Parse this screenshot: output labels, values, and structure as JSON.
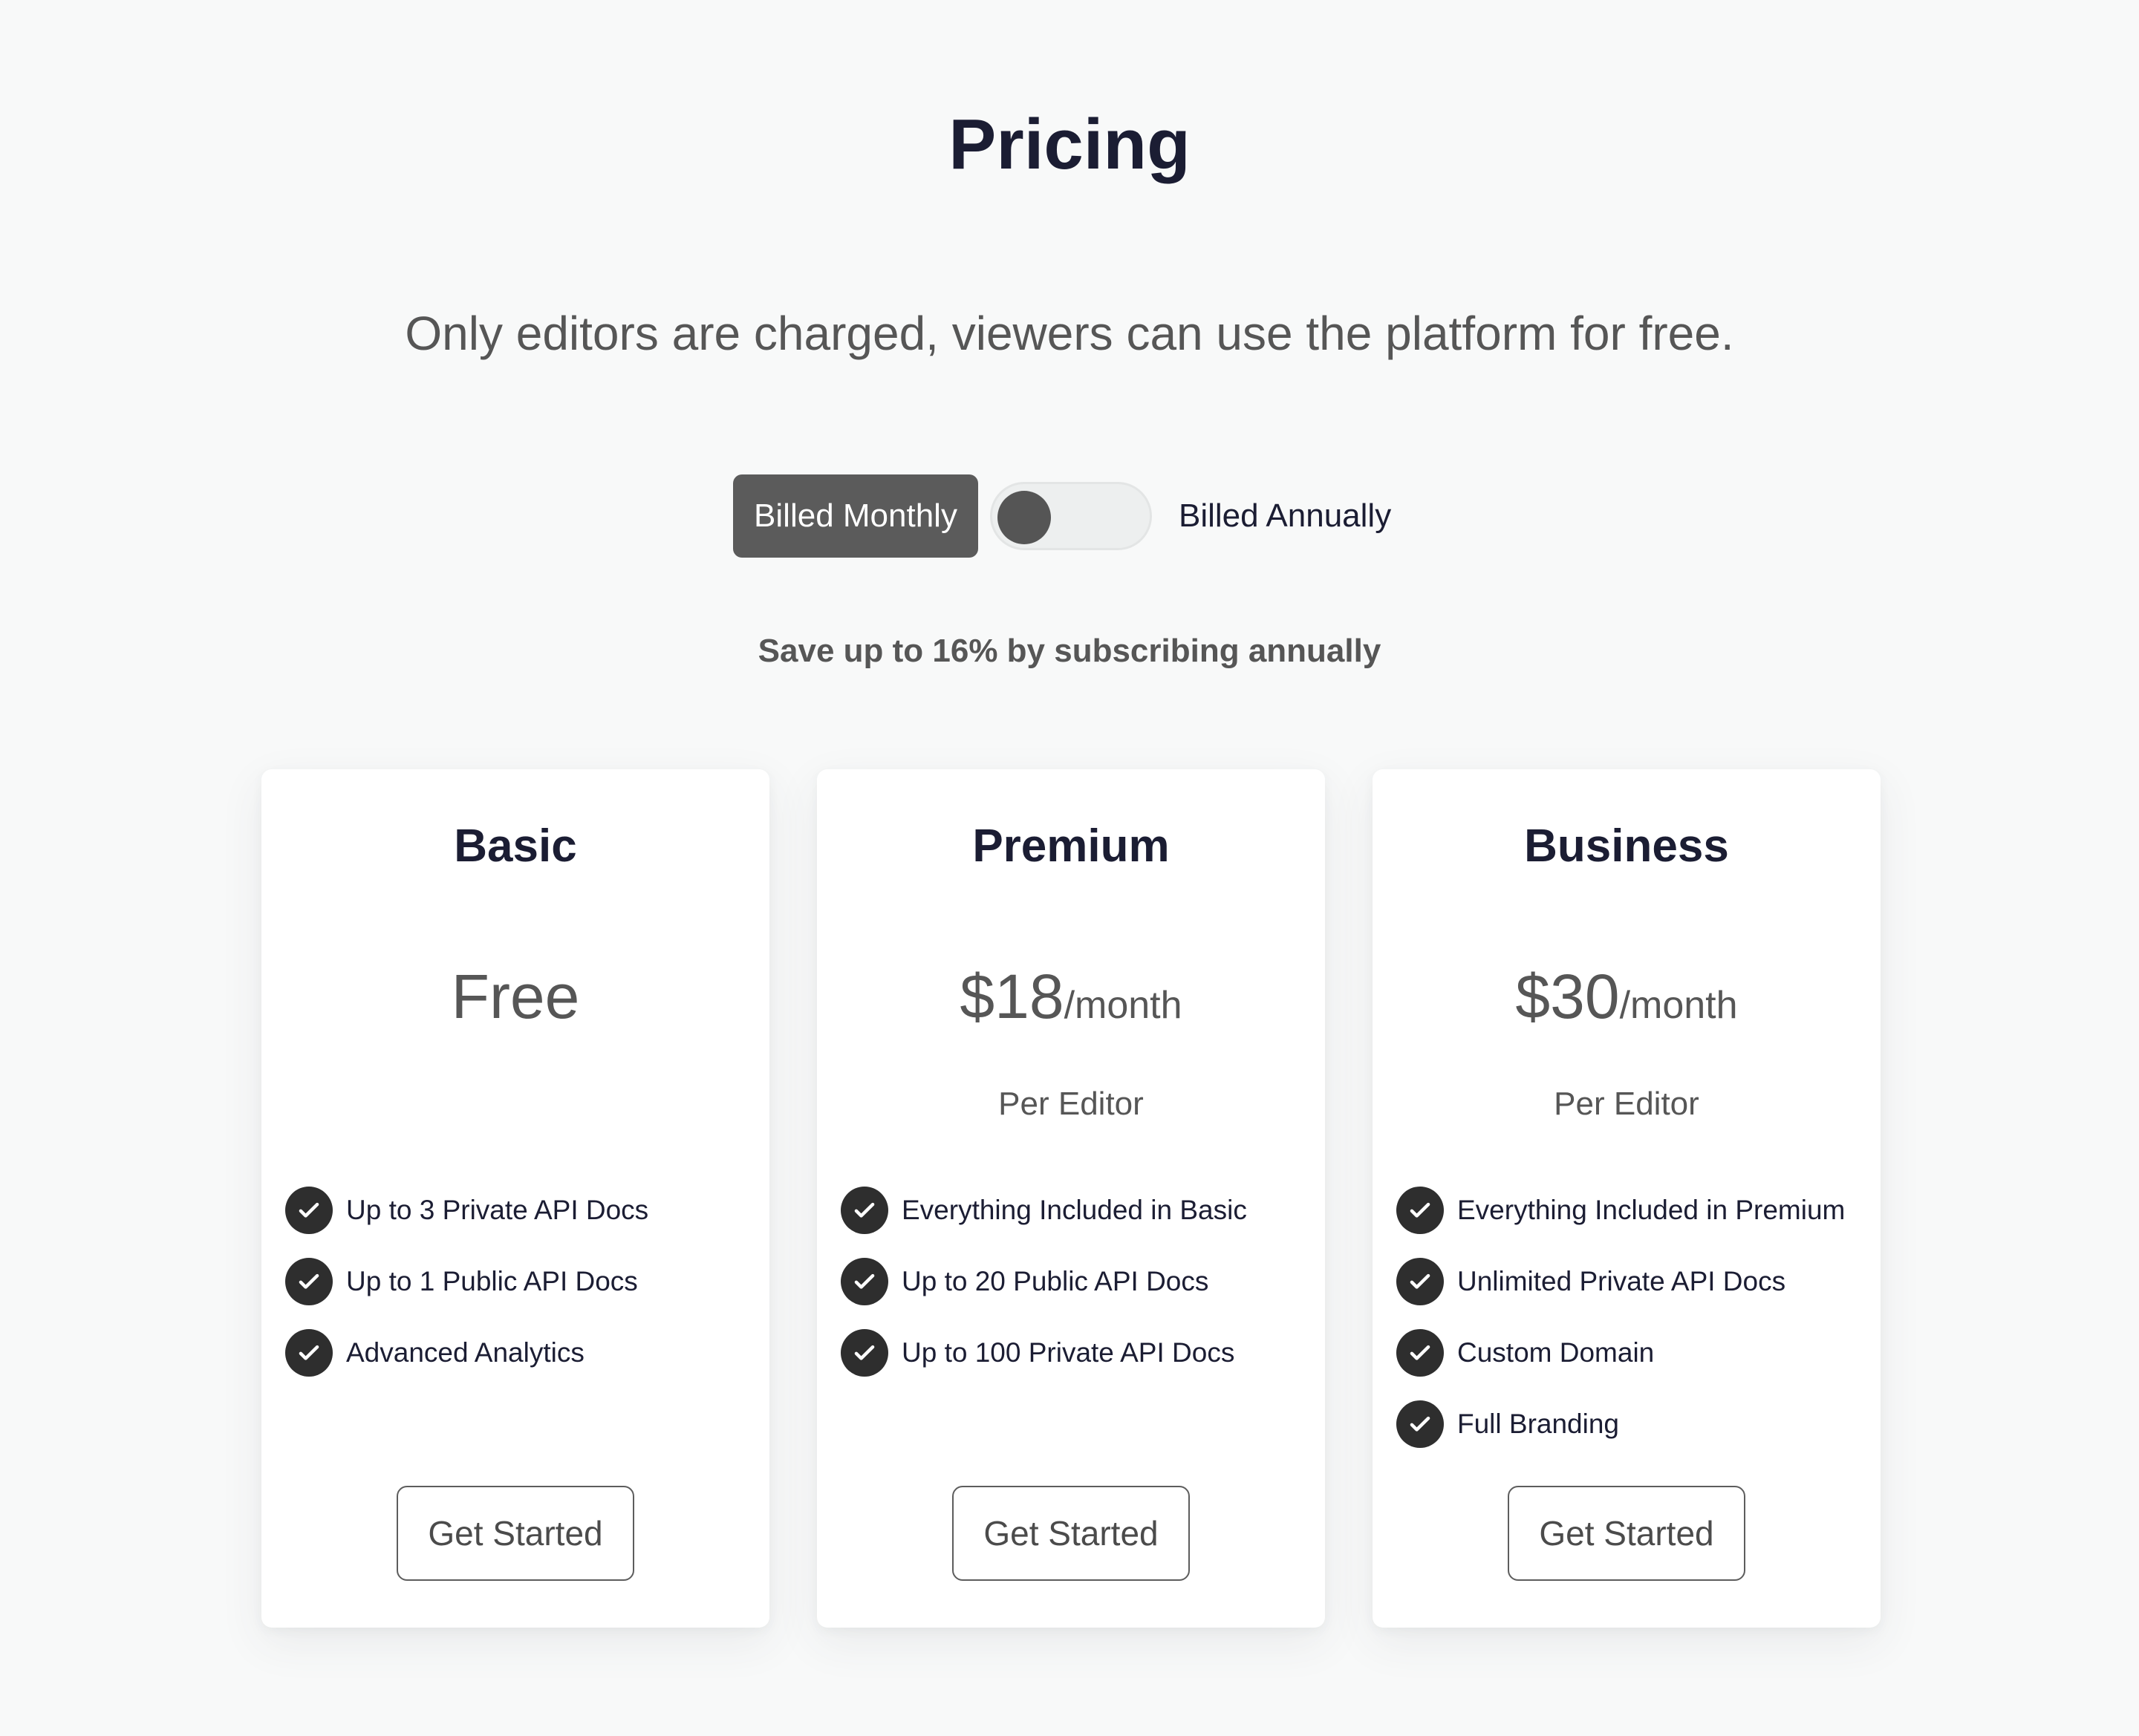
{
  "header": {
    "title": "Pricing",
    "subtitle": "Only editors are charged, viewers can use the platform for free."
  },
  "billing": {
    "monthly_label": "Billed Monthly",
    "annually_label": "Billed Annually",
    "toggle_state": "monthly",
    "save_note": "Save up to 16% by subscribing annually"
  },
  "plans": [
    {
      "name": "Basic",
      "price": "Free",
      "period": "",
      "per": "",
      "features": [
        "Up to 3 Private API Docs",
        "Up to 1 Public API Docs",
        "Advanced Analytics"
      ],
      "cta": "Get Started"
    },
    {
      "name": "Premium",
      "price": "$18",
      "period": "/month",
      "per": "Per Editor",
      "features": [
        "Everything Included in Basic",
        "Up to 20 Public API Docs",
        "Up to 100 Private API Docs"
      ],
      "cta": "Get Started"
    },
    {
      "name": "Business",
      "price": "$30",
      "period": "/month",
      "per": "Per Editor",
      "features": [
        "Everything Included in Premium",
        "Unlimited Private API Docs",
        "Custom Domain",
        "Full Branding"
      ],
      "cta": "Get Started"
    }
  ],
  "icons": {
    "feature_check": "check-circle-icon"
  },
  "colors": {
    "heading": "#1b1d33",
    "active_toggle_bg": "#5b5b5b",
    "check_bg": "#2e2e2e",
    "muted_text": "#565656"
  }
}
